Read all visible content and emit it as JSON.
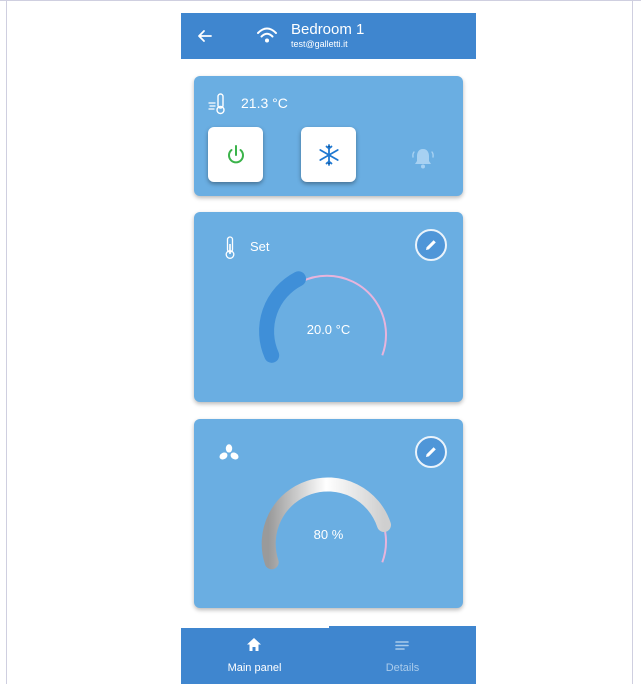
{
  "header": {
    "title": "Bedroom 1",
    "subtitle": "test@galletti.it",
    "back_icon": "arrow-left-icon",
    "wifi_icon": "wifi-icon"
  },
  "status_card": {
    "room_temperature": "21.3 °C",
    "power_icon": "power-icon",
    "mode_icon": "snowflake-icon",
    "alarm_icon": "bell-icon"
  },
  "setpoint_card": {
    "label": "Set",
    "value": "20.0 °C",
    "edit_icon": "pencil-icon"
  },
  "fan_card": {
    "value": "80 %",
    "level": 0.8,
    "edit_icon": "pencil-icon"
  },
  "bottom_nav": {
    "items": [
      {
        "label": "Main panel",
        "icon": "home-icon",
        "active": true
      },
      {
        "label": "Details",
        "icon": "list-icon",
        "active": false
      }
    ]
  },
  "colors": {
    "primary": "#3f86cf",
    "card": "#6aaee2",
    "power_green": "#3bb34a",
    "snow_blue": "#1f78d1",
    "gauge_track": "#e7b4dc"
  }
}
